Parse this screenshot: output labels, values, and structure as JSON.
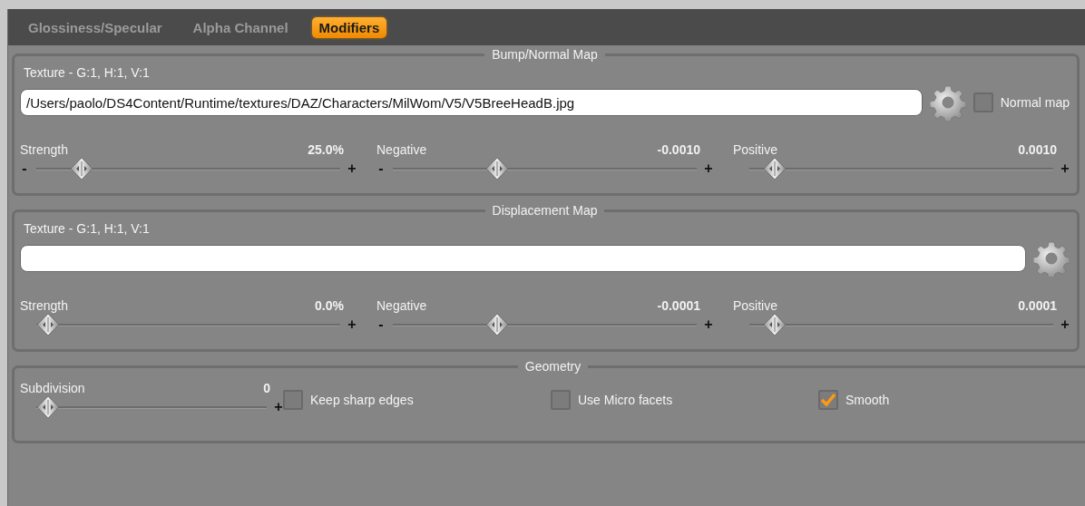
{
  "tabs": [
    {
      "label": "Glossiness/Specular",
      "selected": false
    },
    {
      "label": "Alpha Channel",
      "selected": false
    },
    {
      "label": "Modifiers",
      "selected": true
    }
  ],
  "sections": [
    {
      "title": "Bump/Normal Map",
      "texture_label": "Texture - G:1, H:1, V:1",
      "texture_path": "/Users/paolo/DS4Content/Runtime/textures/DAZ/Characters/MilWom/V5/V5BreeHeadB.jpg",
      "normal_map": {
        "label": "Normal map",
        "checked": false
      },
      "sliders": [
        {
          "label": "Strength",
          "value": "25.0%",
          "minus": "-",
          "plus": "+",
          "level": 0.12
        },
        {
          "label": "Negative",
          "value": "-0.0010",
          "minus": "-",
          "plus": "+",
          "level": 0.33
        },
        {
          "label": "Positive",
          "value": "0.0010",
          "plus": "+",
          "level": 0.05
        }
      ]
    },
    {
      "title": "Displacement Map",
      "texture_label": "Texture - G:1, H:1, V:1",
      "sliders": [
        {
          "label": "Strength",
          "value": "0.0%",
          "plus": "+",
          "level": 0.0
        },
        {
          "label": "Negative",
          "value": "-0.0001",
          "minus": "-",
          "plus": "+",
          "level": 0.33
        },
        {
          "label": "Positive",
          "value": "0.0001",
          "plus": "+",
          "level": 0.05
        }
      ]
    }
  ],
  "geometry": {
    "title": "Geometry",
    "subdivision": {
      "label": "Subdivision",
      "value": "0",
      "plus": "+",
      "level": 0.0
    },
    "options": [
      {
        "label": "Keep sharp edges",
        "checked": false
      },
      {
        "label": "Use Micro facets",
        "checked": false
      },
      {
        "label": "Smooth",
        "checked": true
      }
    ]
  }
}
